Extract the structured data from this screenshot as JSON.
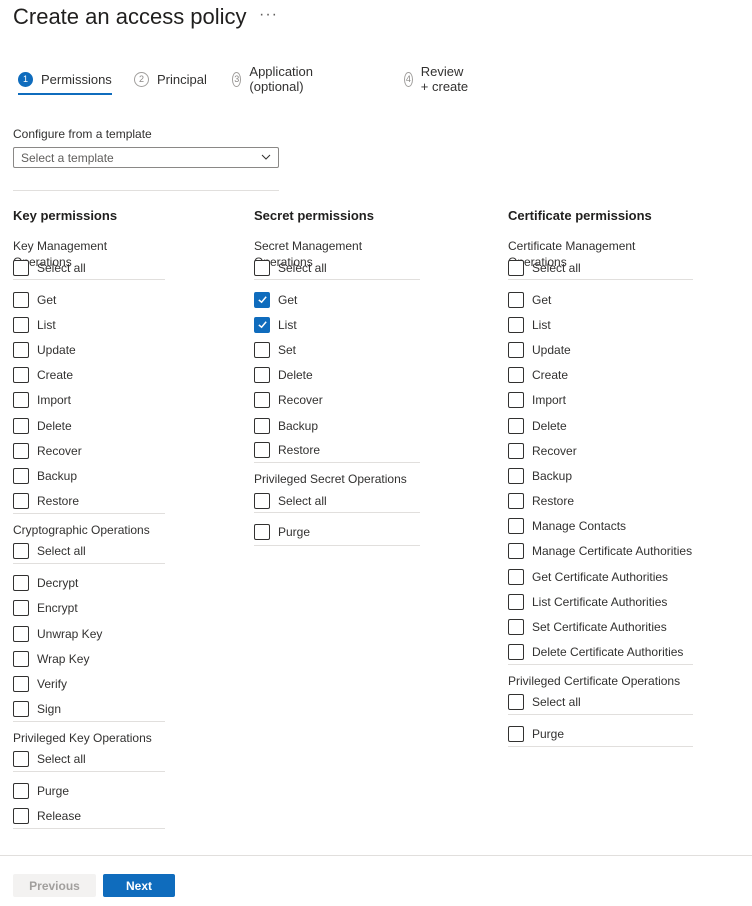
{
  "header": {
    "title": "Create an access policy",
    "more": "···"
  },
  "steps": [
    {
      "num": "1",
      "label": "Permissions",
      "active": true
    },
    {
      "num": "2",
      "label": "Principal",
      "active": false
    },
    {
      "num": "3",
      "label": "Application (optional)",
      "active": false
    },
    {
      "num": "4",
      "label": "Review + create",
      "active": false
    }
  ],
  "template": {
    "label": "Configure from a template",
    "placeholder": "Select a template"
  },
  "columns": {
    "key": {
      "title": "Key permissions",
      "groups": [
        {
          "title": "Key Management Operations",
          "select_all": "Select all",
          "items": [
            "Get",
            "List",
            "Update",
            "Create",
            "Import",
            "Delete",
            "Recover",
            "Backup",
            "Restore"
          ],
          "checked": []
        },
        {
          "title": "Cryptographic Operations",
          "select_all": "Select all",
          "items": [
            "Decrypt",
            "Encrypt",
            "Unwrap Key",
            "Wrap Key",
            "Verify",
            "Sign"
          ],
          "checked": []
        },
        {
          "title": "Privileged Key Operations",
          "select_all": "Select all",
          "items": [
            "Purge",
            "Release"
          ],
          "checked": []
        }
      ]
    },
    "secret": {
      "title": "Secret permissions",
      "groups": [
        {
          "title": "Secret Management Operations",
          "select_all": "Select all",
          "items": [
            "Get",
            "List",
            "Set",
            "Delete",
            "Recover",
            "Backup",
            "Restore"
          ],
          "checked": [
            "Get",
            "List"
          ]
        },
        {
          "title": "Privileged Secret Operations",
          "select_all": "Select all",
          "items": [
            "Purge"
          ],
          "checked": []
        }
      ]
    },
    "cert": {
      "title": "Certificate permissions",
      "groups": [
        {
          "title": "Certificate Management Operations",
          "select_all": "Select all",
          "items": [
            "Get",
            "List",
            "Update",
            "Create",
            "Import",
            "Delete",
            "Recover",
            "Backup",
            "Restore",
            "Manage Contacts",
            "Manage Certificate Authorities",
            "Get Certificate Authorities",
            "List Certificate Authorities",
            "Set Certificate Authorities",
            "Delete Certificate Authorities"
          ],
          "checked": []
        },
        {
          "title": "Privileged Certificate Operations",
          "select_all": "Select all",
          "items": [
            "Purge"
          ],
          "checked": []
        }
      ]
    }
  },
  "footer": {
    "previous": "Previous",
    "next": "Next"
  },
  "colors": {
    "accent": "#0f6cbd"
  }
}
